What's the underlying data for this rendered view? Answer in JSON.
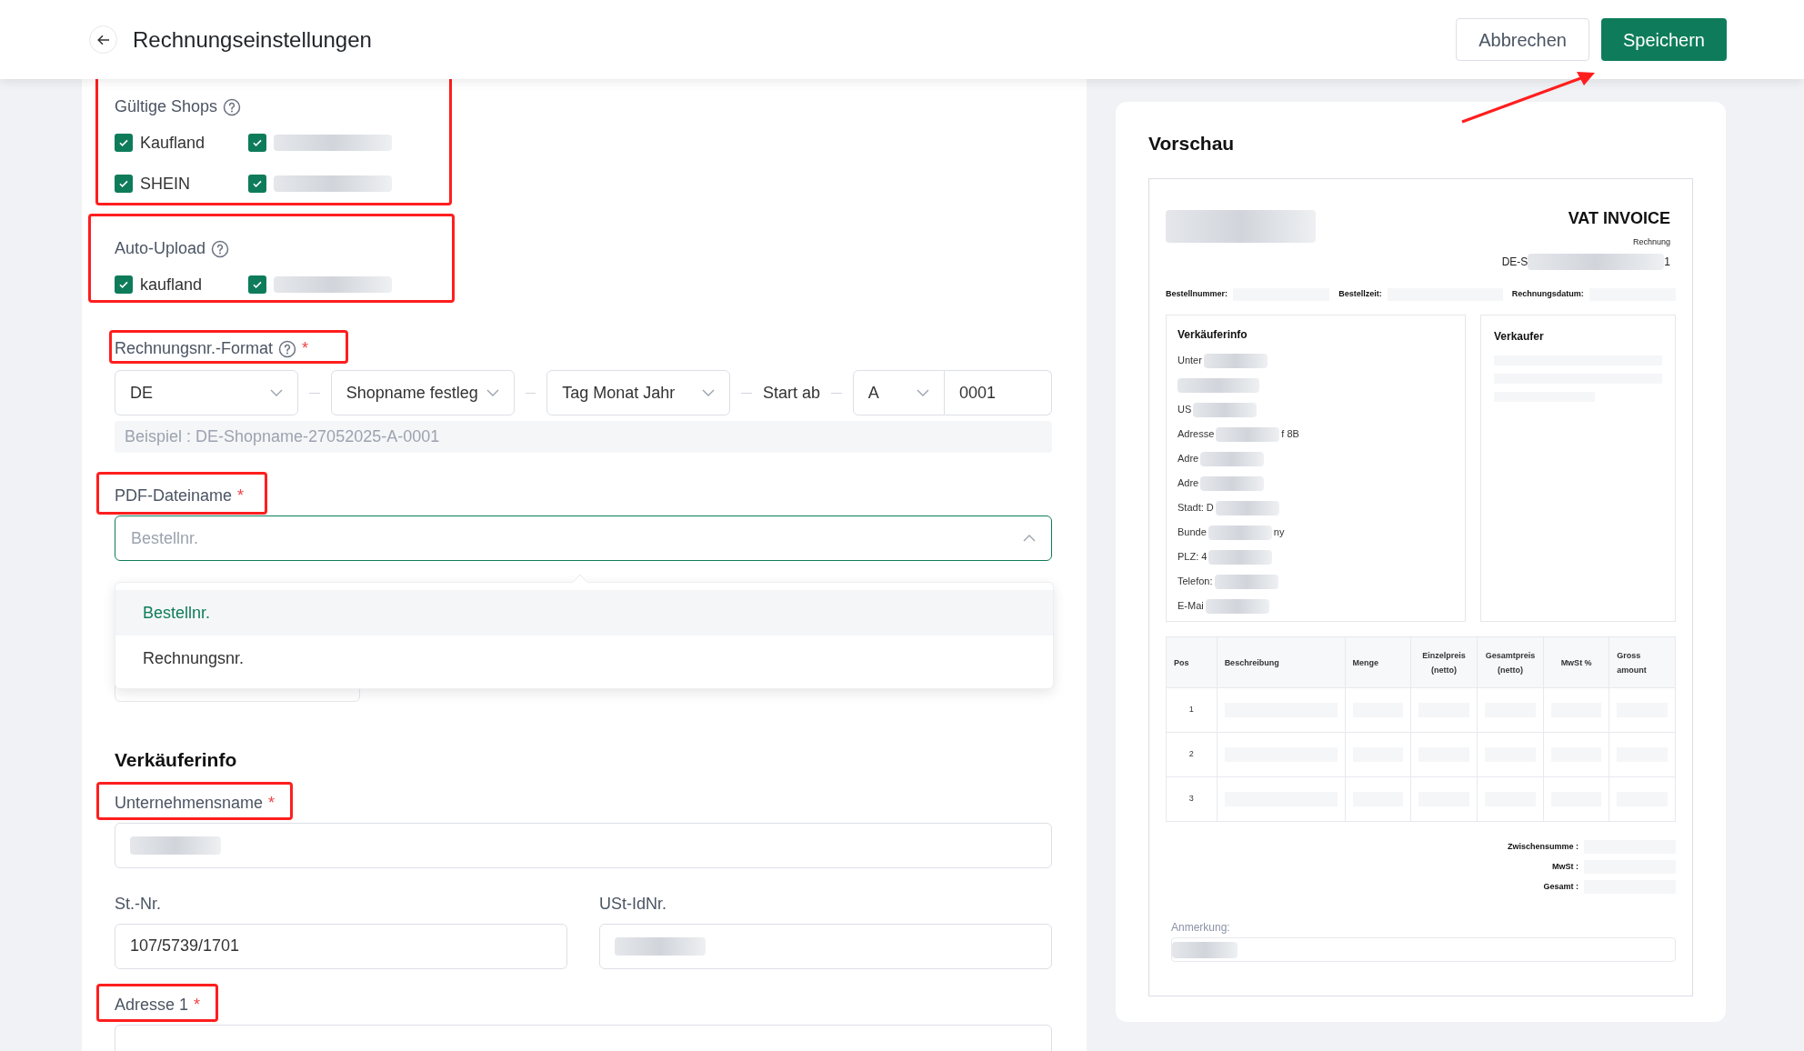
{
  "header": {
    "title": "Rechnungseinstellungen",
    "buttons": [
      {
        "label": "Abbrechen",
        "kind": "secondary"
      },
      {
        "label": "Speichern",
        "kind": "primary"
      }
    ],
    "pointer_arrow": true
  },
  "valid_shops": {
    "label": "Gültige Shops",
    "highlighted": true,
    "shops": [
      {
        "kind": "text",
        "label": "Kaufland",
        "checked": true
      },
      {
        "kind": "redacted",
        "checked": true
      },
      {
        "kind": "text",
        "label": "SHEIN",
        "checked": true
      },
      {
        "kind": "redacted",
        "checked": true
      }
    ]
  },
  "auto_upload": {
    "label": "Auto-Upload",
    "highlighted": true,
    "shops": [
      {
        "kind": "text",
        "label": "kaufland",
        "checked": true
      },
      {
        "kind": "redacted",
        "checked": true
      }
    ]
  },
  "invoice_number_format": {
    "label": "Rechnungsnr.-Format",
    "required_mark": "*",
    "highlighted": true,
    "parts": [
      {
        "kind": "select",
        "value": "DE"
      },
      {
        "kind": "select",
        "value": "Shopname festleg"
      },
      {
        "kind": "select",
        "value": "Tag Monat Jahr"
      },
      {
        "kind": "text",
        "value": "Start ab"
      },
      {
        "kind": "select",
        "value": "A"
      },
      {
        "kind": "input",
        "value": "0001"
      }
    ],
    "example": "Beispiel : DE-Shopname-27052025-A-0001"
  },
  "pdf_filename": {
    "label": "PDF-Dateiname",
    "required_mark": "*",
    "highlighted": true,
    "placeholder": "Bestellnr.",
    "expanded": true,
    "options": [
      {
        "label": "Bestellnr.",
        "selected": true
      },
      {
        "label": "Rechnungsnr.",
        "selected": false
      }
    ]
  },
  "seller_info": {
    "heading": "Verkäuferinfo",
    "rows": [
      {
        "fields": [
          {
            "label": "Unternehmensname",
            "required_mark": "*",
            "highlighted": true,
            "redacted": true
          }
        ]
      },
      {
        "fields": [
          {
            "label": "St.-Nr.",
            "highlighted": false,
            "value": "107/5739/1701"
          },
          {
            "label": "USt-IdNr.",
            "highlighted": false,
            "redacted": true
          }
        ]
      },
      {
        "fields": [
          {
            "label": "Adresse 1",
            "required_mark": "*",
            "highlighted": true
          }
        ]
      }
    ]
  },
  "preview": {
    "title": "Vorschau",
    "invoice": {
      "heading": "VAT INVOICE",
      "number_label": "Rechnung",
      "number_start": "DE-S",
      "number_end": "1",
      "meta": [
        "Bestellnummer:",
        "Bestellzeit:",
        "Rechnungsdatum:"
      ],
      "seller": {
        "title": "Verkäuferinfo",
        "lines": [
          {
            "kind": "text",
            "text": "Unter"
          },
          {
            "kind": "redacted"
          },
          {
            "kind": "text",
            "text": "US"
          },
          {
            "kind": "text",
            "text": "Adresse",
            "tail": "f 8B"
          },
          {
            "kind": "text",
            "text": "Adre"
          },
          {
            "kind": "text",
            "text": "Adre"
          },
          {
            "kind": "text",
            "text": "Stadt: D"
          },
          {
            "kind": "text",
            "text": "Bunde",
            "tail": "ny"
          },
          {
            "kind": "text",
            "text": "PLZ: 4"
          },
          {
            "kind": "text",
            "text": "Telefon:"
          },
          {
            "kind": "text",
            "text": "E-Mai"
          }
        ]
      },
      "buyer": {
        "title": "Verkaufer"
      },
      "table": {
        "columns": [
          "Pos",
          "Beschreibung",
          "Menge",
          "Einzelpreis (netto)",
          "Gesamtpreis (netto)",
          "MwSt %",
          "Gross amount"
        ],
        "rows": [
          "1",
          "2",
          "3"
        ]
      },
      "totals": [
        "Zwischensumme :",
        "MwSt :",
        "Gesamt :"
      ],
      "note_label": "Anmerkung:"
    }
  }
}
